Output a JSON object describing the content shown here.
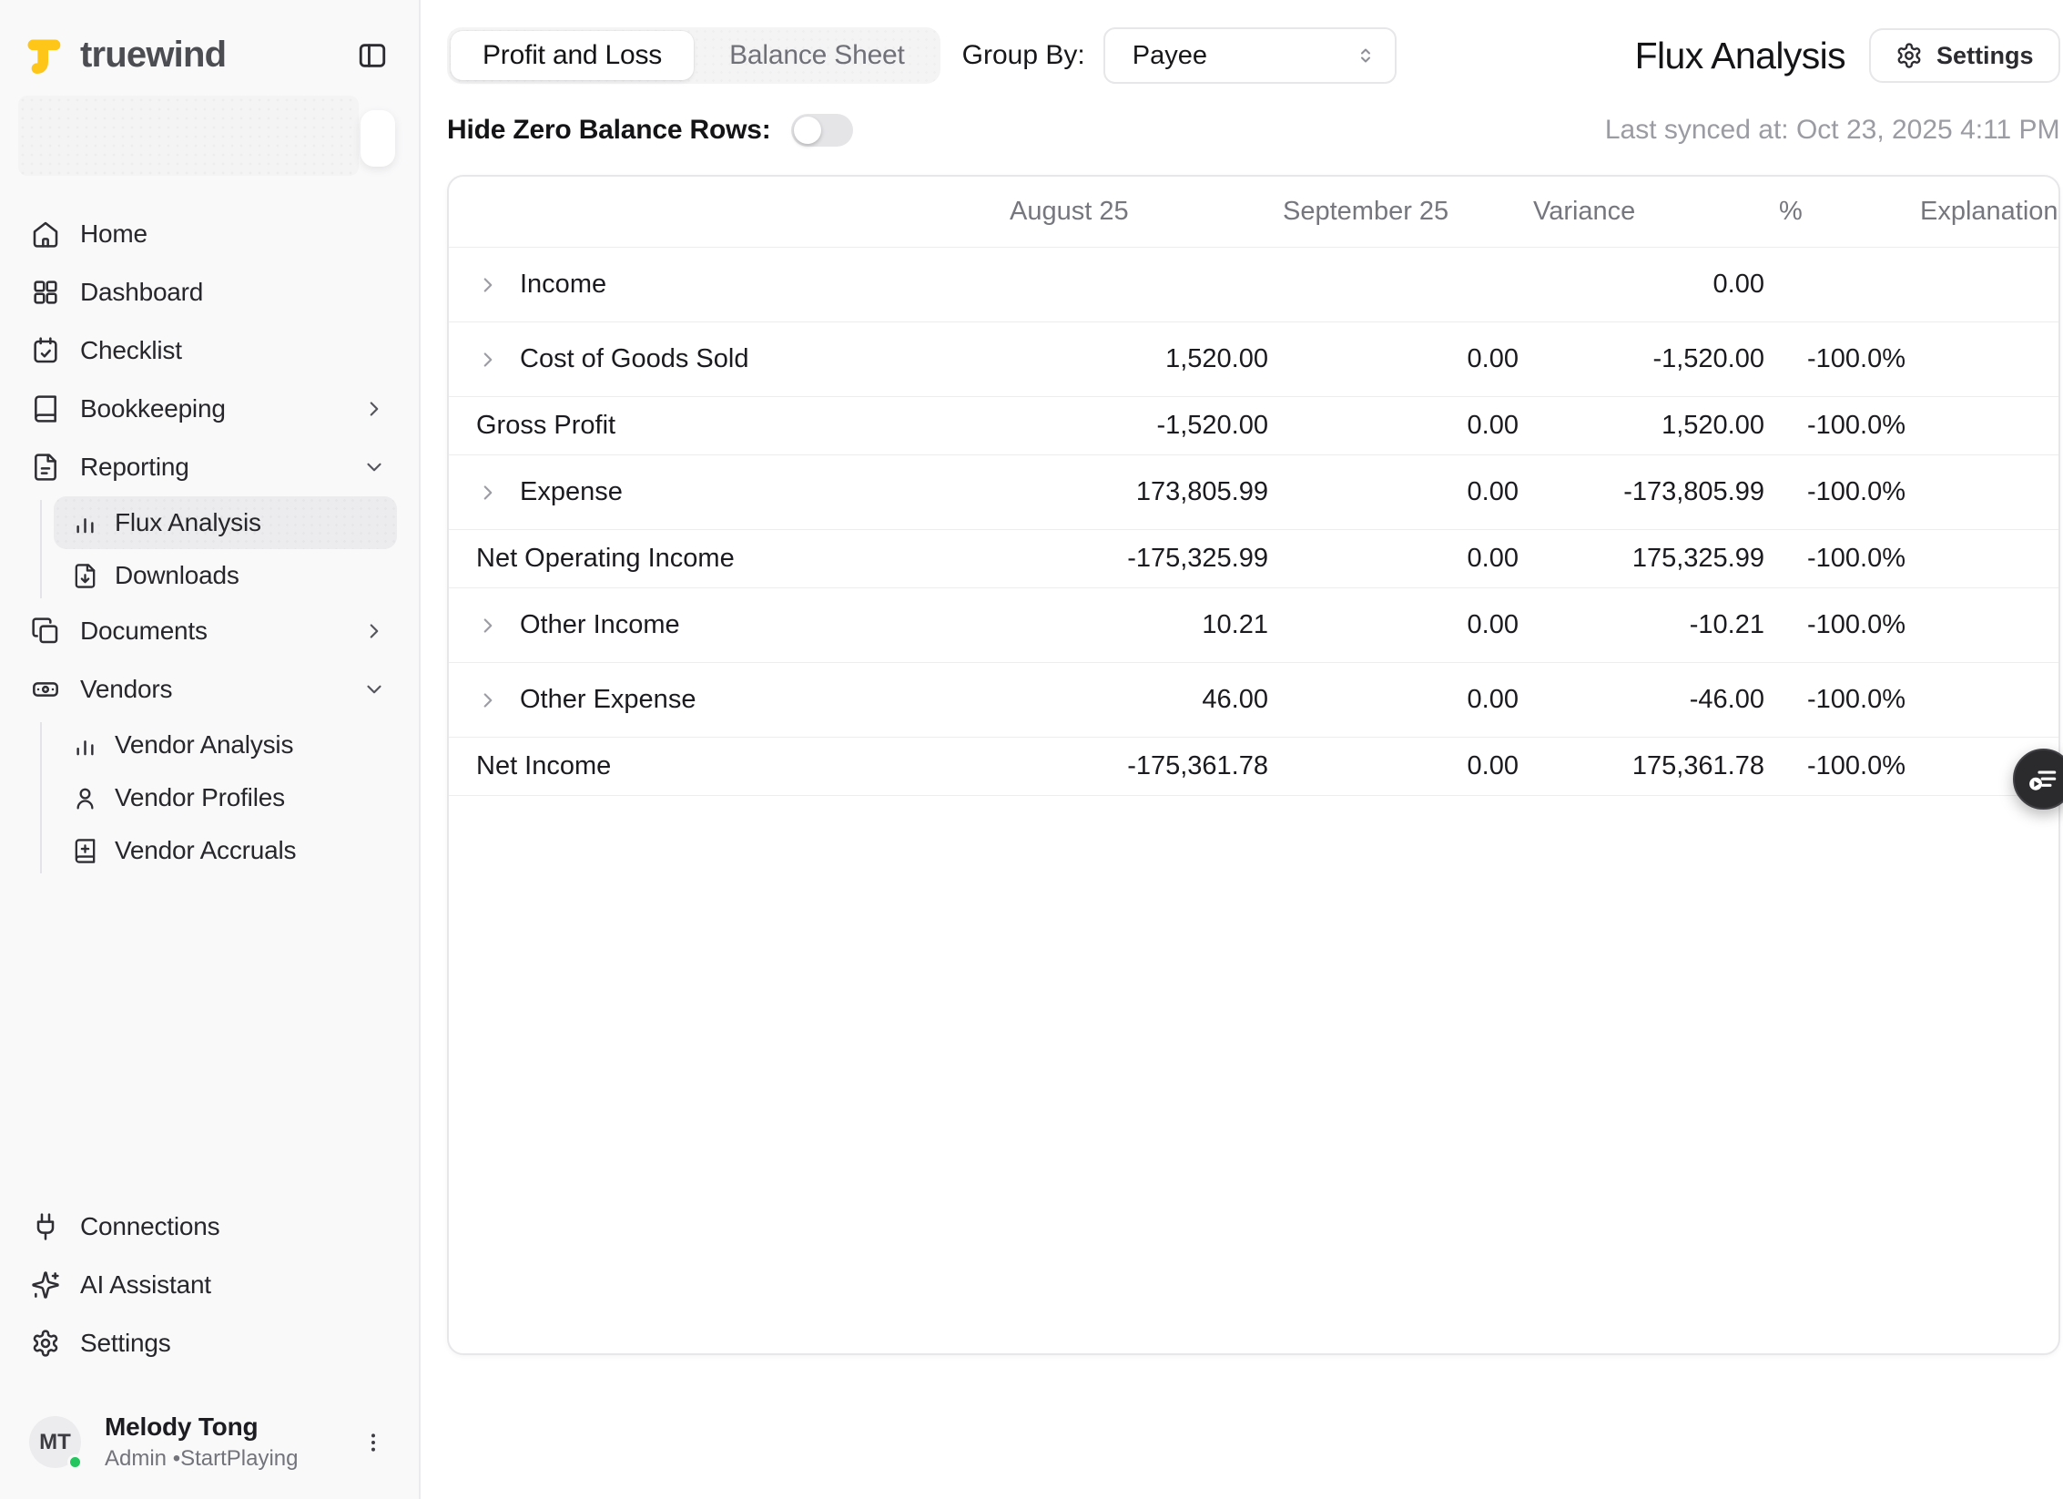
{
  "brand": {
    "name": "truewind"
  },
  "colors": {
    "brand_yellow": "#FFC61A",
    "online_green": "#22c55e",
    "accent_dark": "#2b2b2e"
  },
  "sidebar": {
    "items": {
      "home": "Home",
      "dashboard": "Dashboard",
      "checklist": "Checklist",
      "bookkeeping": "Bookkeeping",
      "reporting": "Reporting",
      "flux_analysis": "Flux Analysis",
      "downloads": "Downloads",
      "documents": "Documents",
      "vendors": "Vendors",
      "vendor_analysis": "Vendor Analysis",
      "vendor_profiles": "Vendor Profiles",
      "vendor_accruals": "Vendor Accruals",
      "connections": "Connections",
      "ai_assistant": "AI Assistant",
      "settings": "Settings"
    },
    "active_item": "Flux Analysis",
    "user": {
      "initials": "MT",
      "name": "Melody Tong",
      "meta": "Admin •StartPlaying",
      "status": "online"
    }
  },
  "header": {
    "tabs": {
      "profit_and_loss": "Profit and Loss",
      "balance_sheet": "Balance Sheet"
    },
    "active_tab": "Profit and Loss",
    "group_by_label": "Group By:",
    "group_by_value": "Payee",
    "page_title": "Flux Analysis",
    "settings_button": "Settings",
    "hide_zero_label": "Hide Zero Balance Rows:",
    "hide_zero_enabled": false,
    "last_synced": "Last synced at: Oct 23, 2025 4:11 PM"
  },
  "table": {
    "columns": {
      "name": "",
      "period1": "August 25",
      "period2": "September 25",
      "variance": "Variance",
      "percent": "%",
      "explanation": "Explanation"
    },
    "rows": [
      {
        "name": "Income",
        "expandable": true,
        "period1": "",
        "period2": "",
        "variance": "0.00",
        "percent": "",
        "explanation": ""
      },
      {
        "name": "Cost of Goods Sold",
        "expandable": true,
        "period1": "1,520.00",
        "period2": "0.00",
        "variance": "-1,520.00",
        "percent": "-100.0%",
        "explanation": ""
      },
      {
        "name": "Gross Profit",
        "expandable": false,
        "period1": "-1,520.00",
        "period2": "0.00",
        "variance": "1,520.00",
        "percent": "-100.0%",
        "explanation": ""
      },
      {
        "name": "Expense",
        "expandable": true,
        "period1": "173,805.99",
        "period2": "0.00",
        "variance": "-173,805.99",
        "percent": "-100.0%",
        "explanation": ""
      },
      {
        "name": "Net Operating Income",
        "expandable": false,
        "period1": "-175,325.99",
        "period2": "0.00",
        "variance": "175,325.99",
        "percent": "-100.0%",
        "explanation": ""
      },
      {
        "name": "Other Income",
        "expandable": true,
        "period1": "10.21",
        "period2": "0.00",
        "variance": "-10.21",
        "percent": "-100.0%",
        "explanation": ""
      },
      {
        "name": "Other Expense",
        "expandable": true,
        "period1": "46.00",
        "period2": "0.00",
        "variance": "-46.00",
        "percent": "-100.0%",
        "explanation": ""
      },
      {
        "name": "Net Income",
        "expandable": false,
        "period1": "-175,361.78",
        "period2": "0.00",
        "variance": "175,361.78",
        "percent": "-100.0%",
        "explanation": ""
      }
    ]
  }
}
